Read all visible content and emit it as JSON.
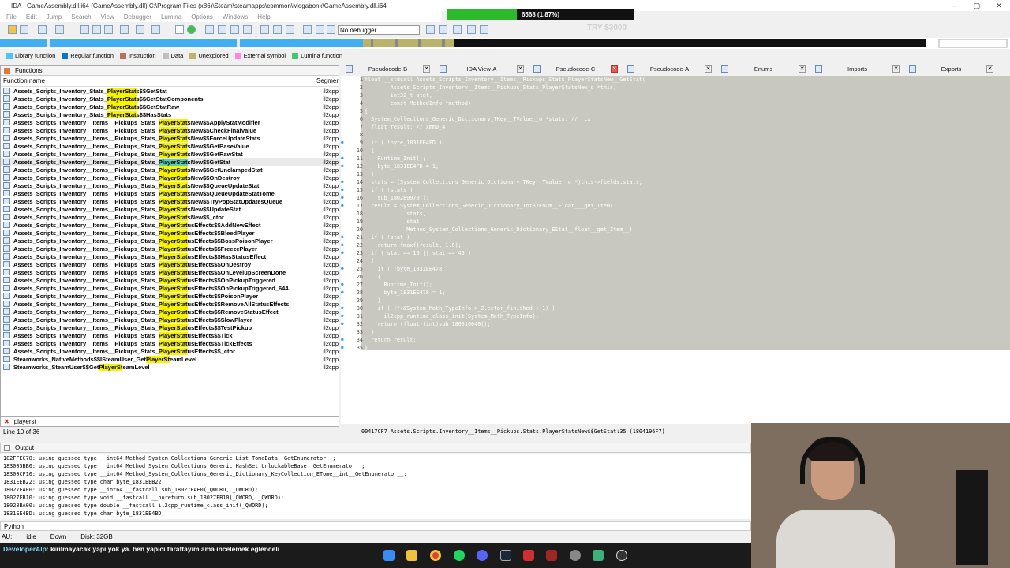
{
  "window": {
    "title": "IDA - GameAssembly.dll.i64 (GameAssembly.dll) C:\\Program Files (x86)\\Steam\\steamapps\\common\\Megabonk\\GameAssembly.dll.i64",
    "progress_text": "6568 (1.87%)",
    "progress_fraction": 0.0187,
    "minimize": "–",
    "maximize": "▢",
    "close": "✕"
  },
  "menu": [
    "File",
    "Edit",
    "Jump",
    "Search",
    "View",
    "Debugger",
    "Lumina",
    "Options",
    "Windows",
    "Help"
  ],
  "toolbar": {
    "debugger_select": "No debugger"
  },
  "overlay_text": "TRY $3000",
  "legend": [
    {
      "label": "Library function",
      "color": "#4fc3f7"
    },
    {
      "label": "Regular function",
      "color": "#0d74c8"
    },
    {
      "label": "Instruction",
      "color": "#b4735a"
    },
    {
      "label": "Data",
      "color": "#c0c0c0"
    },
    {
      "label": "Unexplored",
      "color": "#b9b36c"
    },
    {
      "label": "External symbol",
      "color": "#ff86e8"
    },
    {
      "label": "Lumina function",
      "color": "#40c870"
    }
  ],
  "functions_panel": {
    "title": "Functions",
    "col_name": "Function name",
    "col_segment": "Segmer",
    "rows": [
      {
        "pre": "Assets_Scripts_Inventory_Stats_",
        "hl": "PlayerStat",
        "post": "s$$GetStat",
        "seg": "il2cpp"
      },
      {
        "pre": "Assets_Scripts_Inventory_Stats_",
        "hl": "PlayerStat",
        "post": "s$$GetStatComponents",
        "seg": "il2cpp"
      },
      {
        "pre": "Assets_Scripts_Inventory_Stats_",
        "hl": "PlayerStat",
        "post": "s$$GetStatRaw",
        "seg": "il2cpp"
      },
      {
        "pre": "Assets_Scripts_Inventory_Stats_",
        "hl": "PlayerStat",
        "post": "s$$HasStats",
        "seg": "il2cpp"
      },
      {
        "pre": "Assets_Scripts_Inventory__Items__Pickups_Stats_",
        "hl": "PlayerStat",
        "post": "sNew$$ApplyStatModifier",
        "seg": "il2cpp"
      },
      {
        "pre": "Assets_Scripts_Inventory__Items__Pickups_Stats_",
        "hl": "PlayerStat",
        "post": "sNew$$CheckFinalValue",
        "seg": "il2cpp"
      },
      {
        "pre": "Assets_Scripts_Inventory__Items__Pickups_Stats_",
        "hl": "PlayerStat",
        "post": "sNew$$ForceUpdateStats",
        "seg": "il2cpp"
      },
      {
        "pre": "Assets_Scripts_Inventory__Items__Pickups_Stats_",
        "hl": "PlayerStat",
        "post": "sNew$$GetBaseValue",
        "seg": "il2cpp"
      },
      {
        "pre": "Assets_Scripts_Inventory__Items__Pickups_Stats_",
        "hl": "PlayerStat",
        "post": "sNew$$GetRawStat",
        "seg": "il2cpp"
      },
      {
        "pre": "Assets_Scripts_Inventory__Items__Pickups_Stats_",
        "hl": "PlayerStat",
        "post": "sNew$$GetStat",
        "seg": "il2cpp"
      },
      {
        "pre": "Assets_Scripts_Inventory__Items__Pickups_Stats_",
        "hl": "PlayerStat",
        "post": "sNew$$GetUnclampedStat",
        "seg": "il2cpp"
      },
      {
        "pre": "Assets_Scripts_Inventory__Items__Pickups_Stats_",
        "hl": "PlayerStat",
        "post": "sNew$$OnDestroy",
        "seg": "il2cpp"
      },
      {
        "pre": "Assets_Scripts_Inventory__Items__Pickups_Stats_",
        "hl": "PlayerStat",
        "post": "sNew$$QueueUpdateStat",
        "seg": "il2cpp"
      },
      {
        "pre": "Assets_Scripts_Inventory__Items__Pickups_Stats_",
        "hl": "PlayerStat",
        "post": "sNew$$QueueUpdateStatTome",
        "seg": "il2cpp"
      },
      {
        "pre": "Assets_Scripts_Inventory__Items__Pickups_Stats_",
        "hl": "PlayerStat",
        "post": "sNew$$TryPopStatUpdatesQueue",
        "seg": "il2cpp"
      },
      {
        "pre": "Assets_Scripts_Inventory__Items__Pickups_Stats_",
        "hl": "PlayerStat",
        "post": "sNew$$UpdateStat",
        "seg": "il2cpp"
      },
      {
        "pre": "Assets_Scripts_Inventory__Items__Pickups_Stats_",
        "hl": "PlayerStat",
        "post": "sNew$$_ctor",
        "seg": "il2cpp"
      },
      {
        "pre": "Assets_Scripts_Inventory__Items__Pickups_Stats_",
        "hl": "PlayerStat",
        "post": "usEffects$$AddNewEffect",
        "seg": "il2cpp"
      },
      {
        "pre": "Assets_Scripts_Inventory__Items__Pickups_Stats_",
        "hl": "PlayerStat",
        "post": "usEffects$$BleedPlayer",
        "seg": "il2cpp"
      },
      {
        "pre": "Assets_Scripts_Inventory__Items__Pickups_Stats_",
        "hl": "PlayerStat",
        "post": "usEffects$$BossPoisonPlayer",
        "seg": "il2cpp"
      },
      {
        "pre": "Assets_Scripts_Inventory__Items__Pickups_Stats_",
        "hl": "PlayerStat",
        "post": "usEffects$$FreezePlayer",
        "seg": "il2cpp"
      },
      {
        "pre": "Assets_Scripts_Inventory__Items__Pickups_Stats_",
        "hl": "PlayerStat",
        "post": "usEffects$$HasStatusEffect",
        "seg": "il2cpp"
      },
      {
        "pre": "Assets_Scripts_Inventory__Items__Pickups_Stats_",
        "hl": "PlayerStat",
        "post": "usEffects$$OnDestroy",
        "seg": "il2cpp"
      },
      {
        "pre": "Assets_Scripts_Inventory__Items__Pickups_Stats_",
        "hl": "PlayerStat",
        "post": "usEffects$$OnLevelupScreenDone",
        "seg": "il2cpp"
      },
      {
        "pre": "Assets_Scripts_Inventory__Items__Pickups_Stats_",
        "hl": "PlayerStat",
        "post": "usEffects$$OnPickupTriggered",
        "seg": "il2cpp"
      },
      {
        "pre": "Assets_Scripts_Inventory__Items__Pickups_Stats_",
        "hl": "PlayerStat",
        "post": "usEffects$$OnPickupTriggered_644...",
        "seg": "il2cpp"
      },
      {
        "pre": "Assets_Scripts_Inventory__Items__Pickups_Stats_",
        "hl": "PlayerStat",
        "post": "usEffects$$PoisonPlayer",
        "seg": "il2cpp"
      },
      {
        "pre": "Assets_Scripts_Inventory__Items__Pickups_Stats_",
        "hl": "PlayerStat",
        "post": "usEffects$$RemoveAllStatusEffects",
        "seg": "il2cpp"
      },
      {
        "pre": "Assets_Scripts_Inventory__Items__Pickups_Stats_",
        "hl": "PlayerStat",
        "post": "usEffects$$RemoveStatusEffect",
        "seg": "il2cpp"
      },
      {
        "pre": "Assets_Scripts_Inventory__Items__Pickups_Stats_",
        "hl": "PlayerStat",
        "post": "usEffects$$SlowPlayer",
        "seg": "il2cpp"
      },
      {
        "pre": "Assets_Scripts_Inventory__Items__Pickups_Stats_",
        "hl": "PlayerStat",
        "post": "usEffects$$TestPickup",
        "seg": "il2cpp"
      },
      {
        "pre": "Assets_Scripts_Inventory__Items__Pickups_Stats_",
        "hl": "PlayerStat",
        "post": "usEffects$$Tick",
        "seg": "il2cpp"
      },
      {
        "pre": "Assets_Scripts_Inventory__Items__Pickups_Stats_",
        "hl": "PlayerStat",
        "post": "usEffects$$TickEffects",
        "seg": "il2cpp"
      },
      {
        "pre": "Assets_Scripts_Inventory__Items__Pickups_Stats_",
        "hl": "PlayerStat",
        "post": "usEffects$$_ctor",
        "seg": "il2cpp"
      },
      {
        "pre": "Steamworks_NativeMethods$$ISteamUser_Get",
        "hl": "PlayerSt",
        "post": "eamLevel",
        "seg": "il2cpp"
      },
      {
        "pre": "Steamworks_SteamUser$$Get",
        "hl": "PlayerSt",
        "post": "eamLevel",
        "seg": "il2cpp"
      }
    ],
    "selected_index": 9,
    "search_value": "playerst",
    "line_info": "Line 10 of 36"
  },
  "tabs": [
    {
      "label": "Pseudocode-B"
    },
    {
      "label": "IDA View-A"
    },
    {
      "label": "Pseudocode-C",
      "active": true
    },
    {
      "label": "Pseudocode-A"
    },
    {
      "label": "Enums"
    },
    {
      "label": "Imports"
    },
    {
      "label": "Exports"
    }
  ],
  "code_lines": [
    {
      "n": "1",
      "bp": false,
      "t": "float __stdcall Assets_Scripts_Inventory__Items__Pickups_Stats_PlayerStatsNew__GetStat("
    },
    {
      "n": "2",
      "bp": false,
      "t": "        Assets_Scripts_Inventory__Items__Pickups_Stats_PlayerStatsNew_o *this,"
    },
    {
      "n": "3",
      "bp": false,
      "t": "        int32_t stat,"
    },
    {
      "n": "4",
      "bp": false,
      "t": "        const MethodInfo *method)"
    },
    {
      "n": "5",
      "bp": false,
      "t": "{"
    },
    {
      "n": "6",
      "bp": false,
      "t": "  System_Collections_Generic_Dictionary_TKey__TValue__o *stats; // rcx"
    },
    {
      "n": "7",
      "bp": false,
      "t": "  float result; // xmm0_4"
    },
    {
      "n": "8",
      "bp": false,
      "t": ""
    },
    {
      "n": "9",
      "bp": true,
      "t": "  if ( !byte_1831EE4FD )"
    },
    {
      "n": "10",
      "bp": false,
      "t": "  {"
    },
    {
      "n": "11",
      "bp": true,
      "t": "    Runtime_Init();"
    },
    {
      "n": "12",
      "bp": true,
      "t": "    byte_1831EE4FD = 1;"
    },
    {
      "n": "13",
      "bp": false,
      "t": "  }"
    },
    {
      "n": "14",
      "bp": true,
      "t": "  stats = (System_Collections_Generic_Dictionary_TKey__TValue__o *)this->fields.stats;"
    },
    {
      "n": "15",
      "bp": true,
      "t": "  if ( !stats )"
    },
    {
      "n": "16",
      "bp": true,
      "t": "    sub_180280970();"
    },
    {
      "n": "17",
      "bp": true,
      "t": "  result = System_Collections_Generic_Dictionary_Int32Enum__Float___get_Item("
    },
    {
      "n": "18",
      "bp": false,
      "t": "             stats,"
    },
    {
      "n": "19",
      "bp": false,
      "t": "             stat,"
    },
    {
      "n": "20",
      "bp": false,
      "t": "             Method_System_Collections_Generic_Dictionary_EStat__float__get_Item__);"
    },
    {
      "n": "21",
      "bp": true,
      "t": "  if ( !stat )"
    },
    {
      "n": "22",
      "bp": true,
      "t": "    return fmaxf(result, 1.0);"
    },
    {
      "n": "23",
      "bp": true,
      "t": "  if ( stat == 16 || stat == 45 )"
    },
    {
      "n": "24",
      "bp": false,
      "t": "  {"
    },
    {
      "n": "25",
      "bp": true,
      "t": "    if ( !byte_1831EE478 )"
    },
    {
      "n": "26",
      "bp": false,
      "t": "    {"
    },
    {
      "n": "27",
      "bp": true,
      "t": "      Runtime_Init();"
    },
    {
      "n": "28",
      "bp": true,
      "t": "      byte_1831EE478 = 1;"
    },
    {
      "n": "29",
      "bp": false,
      "t": "    }"
    },
    {
      "n": "30",
      "bp": true,
      "t": "    if ( !*(&System_Math_TypeInfo->_2.cctor_finished + 1) )"
    },
    {
      "n": "31",
      "bp": true,
      "t": "      il2cpp_runtime_class_init(System_Math_TypeInfo);"
    },
    {
      "n": "32",
      "bp": true,
      "t": "    return (float)(int)sub_180316040();"
    },
    {
      "n": "33",
      "bp": false,
      "t": "  }"
    },
    {
      "n": "34",
      "bp": true,
      "t": "  return result;"
    },
    {
      "n": "35",
      "bp": true,
      "t": "}"
    }
  ],
  "address_bar": "00417CF7 Assets.Scripts.Inventory__Items__Pickups.Stats.PlayerStatsNew$$GetStat:35 (1804196F7)",
  "output": {
    "title": "Output",
    "lines": [
      "182FFEC78: using guessed type __int64 Method_System_Collections_Generic_List_TomeData__GetEnumerator__;",
      "183005BB0: using guessed type __int64 Method_System_Collections_Generic_HashSet_UnlockableBase__GetEnumerator__;",
      "18300CF10: using guessed type __int64 Method_System_Collections_Generic_Dictionary_KeyCollection_ETome__int__GetEnumerator__;",
      "1831EEB22: using guessed type char byte_1831EEB22;",
      "18027FAE0: using guessed type __int64 __fastcall sub_18027FAE0(_QWORD, _QWORD);",
      "18027FB10: using guessed type void __fastcall __noreturn sub_18027FB10(_QWORD, _QWORD);",
      "18028BA00: using guessed type double __fastcall il2cpp_runtime_class_init(_QWORD);",
      "1831EE4BD: using guessed type char byte_1831EE4BD;"
    ],
    "prompt": "Python"
  },
  "status": {
    "au": "AU:",
    "state": "idle",
    "dir": "Down",
    "disk": "Disk: 32GB"
  },
  "chat": {
    "user": "DeveloperAlp",
    "msg": ": kırılmayacak yapı yok ya. ben yapıcı taraftayım ama incelemek eğlenceli"
  },
  "taskbar_icons": [
    "windows-icon",
    "folder-icon",
    "chrome-icon",
    "spotify-icon",
    "discord-icon",
    "steam-icon",
    "app-icon",
    "ida-icon",
    "settings-icon",
    "app2-icon",
    "obs-icon"
  ]
}
